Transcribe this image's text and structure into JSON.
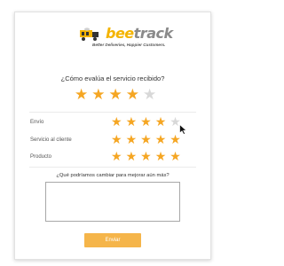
{
  "brand": {
    "name_bee": "bee",
    "name_track": "track",
    "tagline": "Better Deliveries, Happier Customers.",
    "accent": "#f5a623",
    "button_color": "#f5b54a"
  },
  "survey": {
    "question": "¿Cómo evalúa el servicio recibido?",
    "overall_rating": 4,
    "max_rating": 5,
    "categories": [
      {
        "label": "Envío",
        "rating": 4
      },
      {
        "label": "Servicio al cliente",
        "rating": 5
      },
      {
        "label": "Producto",
        "rating": 5
      }
    ],
    "improve_label": "¿Qué podríamos cambiar para mejorar aún más?",
    "improve_value": "",
    "submit_label": "Enviar"
  },
  "icons": {
    "star": "star-icon",
    "logo": "bee-truck-logo-icon",
    "cursor": "mouse-pointer-icon"
  }
}
